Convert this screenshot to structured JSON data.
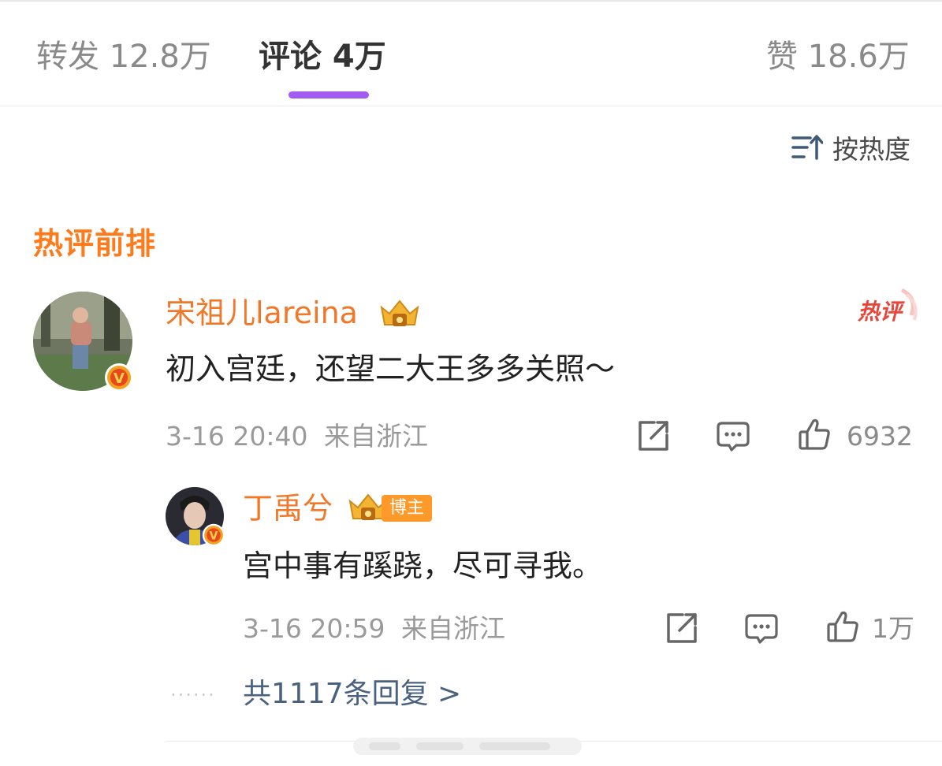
{
  "tabs": {
    "repost": "转发 12.8万",
    "comments": "评论 4万",
    "likes": "赞 18.6万"
  },
  "sort": {
    "label": "按热度",
    "icon": "sort-descending-icon"
  },
  "section_title": "热评前排",
  "colors": {
    "accent_purple": "#a35cf0",
    "brand_orange": "#f07828",
    "hot_red": "#e8463a",
    "link_blue": "#4a6280"
  },
  "comment": {
    "username": "宋祖儿lareina",
    "text": "初入宫廷，还望二大王多多关照～",
    "time": "3-16 20:40",
    "location": "来自浙江",
    "likes": "6932",
    "badge": "热评",
    "icons": [
      "share-icon",
      "comment-icon",
      "like-icon"
    ]
  },
  "reply": {
    "username": "丁禹兮",
    "role_badge": "博主",
    "text": "宫中事有蹊跷，尽可寻我。",
    "time": "3-16 20:59",
    "location": "来自浙江",
    "likes": "1万",
    "icons": [
      "share-icon",
      "comment-icon",
      "like-icon"
    ]
  },
  "more_replies": "共1117条回复 >"
}
